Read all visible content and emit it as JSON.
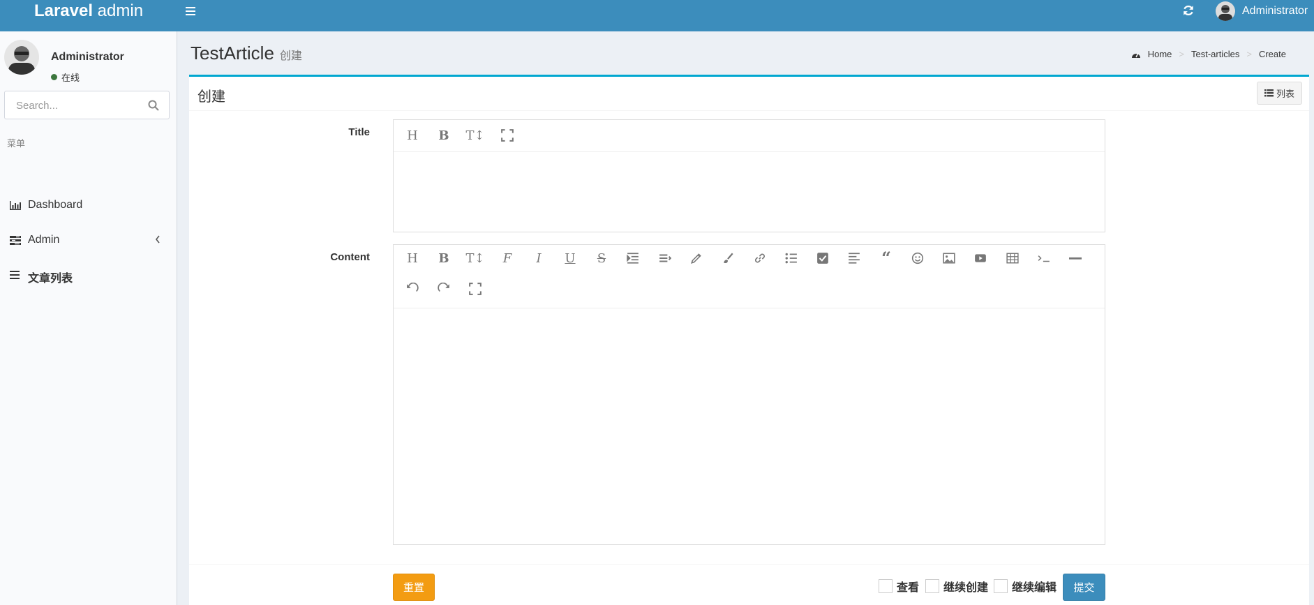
{
  "header": {
    "logo_bold": "Laravel",
    "logo_light": " admin",
    "user_name": "Administrator",
    "bg_color": "#3c8dbc"
  },
  "sidebar": {
    "user_name": "Administrator",
    "status": "在线",
    "search_placeholder": "Search...",
    "menu_header": "菜单",
    "items": [
      {
        "label": "Dashboard",
        "icon": "bar-chart-icon"
      },
      {
        "label": "Admin",
        "icon": "tasks-icon"
      },
      {
        "label": "文章列表",
        "icon": "bars-icon"
      }
    ]
  },
  "content": {
    "title": "TestArticle",
    "subtitle": "创建",
    "breadcrumb": [
      "Home",
      "Test-articles",
      "Create"
    ]
  },
  "box": {
    "title": "创建",
    "list_button": "列表",
    "accent_color": "#00a7d0"
  },
  "form": {
    "title_label": "Title",
    "content_label": "Content",
    "title_toolbar": [
      "heading-icon",
      "bold-icon",
      "text-height-icon",
      "fullscreen-icon"
    ],
    "content_toolbar": [
      "heading-icon",
      "bold-icon",
      "text-height-icon",
      "font-icon",
      "italic-icon",
      "underline-icon",
      "strikethrough-icon",
      "indent-icon",
      "align-icon",
      "brush-icon",
      "paint-brush-icon",
      "link-icon",
      "list-icon",
      "checkbox-icon",
      "align-left-icon",
      "quote-icon",
      "emoji-icon",
      "image-icon",
      "video-icon",
      "table-icon",
      "code-icon",
      "horizontal-rule-icon",
      "undo-icon",
      "redo-icon",
      "fullscreen-icon"
    ],
    "reset_label": "重置",
    "submit_label": "提交",
    "checkboxes": [
      "查看",
      "继续创建",
      "继续编辑"
    ],
    "reset_color": "#f39c12",
    "submit_color": "#3c8dbc"
  }
}
